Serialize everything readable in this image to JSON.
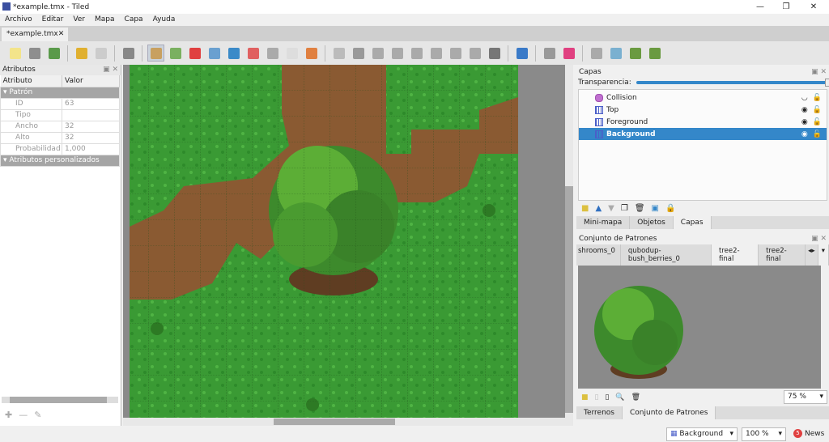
{
  "window": {
    "title": "*example.tmx - Tiled"
  },
  "menu": [
    "Archivo",
    "Editar",
    "Ver",
    "Mapa",
    "Capa",
    "Ayuda"
  ],
  "doc_tab": {
    "label": "*example.tmx",
    "close": "✕"
  },
  "toolbar": [
    "new-map",
    "open",
    "save",
    "undo",
    "redo",
    "commands",
    "stamp-brush",
    "terrain-brush",
    "wang-brush",
    "bucket-fill",
    "shape-fill",
    "eraser",
    "rect-select",
    "magic-wand",
    "select-same",
    "select-objects",
    "edit-polygons",
    "insert-rectangle",
    "insert-point",
    "insert-ellipse",
    "insert-polygon",
    "insert-tile",
    "insert-template",
    "insert-text",
    "move",
    "random-mode",
    "wang-fill",
    "flip-h",
    "flip-v",
    "rotate-left",
    "rotate-right"
  ],
  "properties": {
    "title": "Atributos",
    "headers": [
      "Atributo",
      "Valor"
    ],
    "group1": "Patrón",
    "rows": [
      {
        "k": "ID",
        "v": "63"
      },
      {
        "k": "Tipo",
        "v": ""
      },
      {
        "k": "Ancho",
        "v": "32"
      },
      {
        "k": "Alto",
        "v": "32"
      },
      {
        "k": "Probabilidad",
        "v": "1,000"
      }
    ],
    "group2": "Atributos personalizados"
  },
  "layers": {
    "title": "Capas",
    "opacity_label": "Transparencia:",
    "opacity": 1.0,
    "items": [
      {
        "name": "Collision",
        "visible": false,
        "selected": false
      },
      {
        "name": "Top",
        "visible": true,
        "selected": false
      },
      {
        "name": "Foreground",
        "visible": true,
        "selected": false
      },
      {
        "name": "Background",
        "visible": true,
        "selected": true
      }
    ],
    "tabs": [
      "Mini-mapa",
      "Objetos",
      "Capas"
    ],
    "active_tab": "Capas"
  },
  "tilesets": {
    "title": "Conjunto de Patrones",
    "tabs": [
      "shrooms_0",
      "qubodup-bush_berries_0",
      "tree2-final",
      "tree2-final"
    ],
    "active_tab": 2,
    "zoom": "75 %",
    "bottom_tabs": [
      "Terrenos",
      "Conjunto de Patrones"
    ]
  },
  "status": {
    "layer": "Background",
    "zoom": "100 %",
    "news": "News",
    "news_count": "5"
  },
  "colors": {
    "selection": "#3487c9",
    "grass": "#3a9a34",
    "dirt": "#8a5a32"
  }
}
